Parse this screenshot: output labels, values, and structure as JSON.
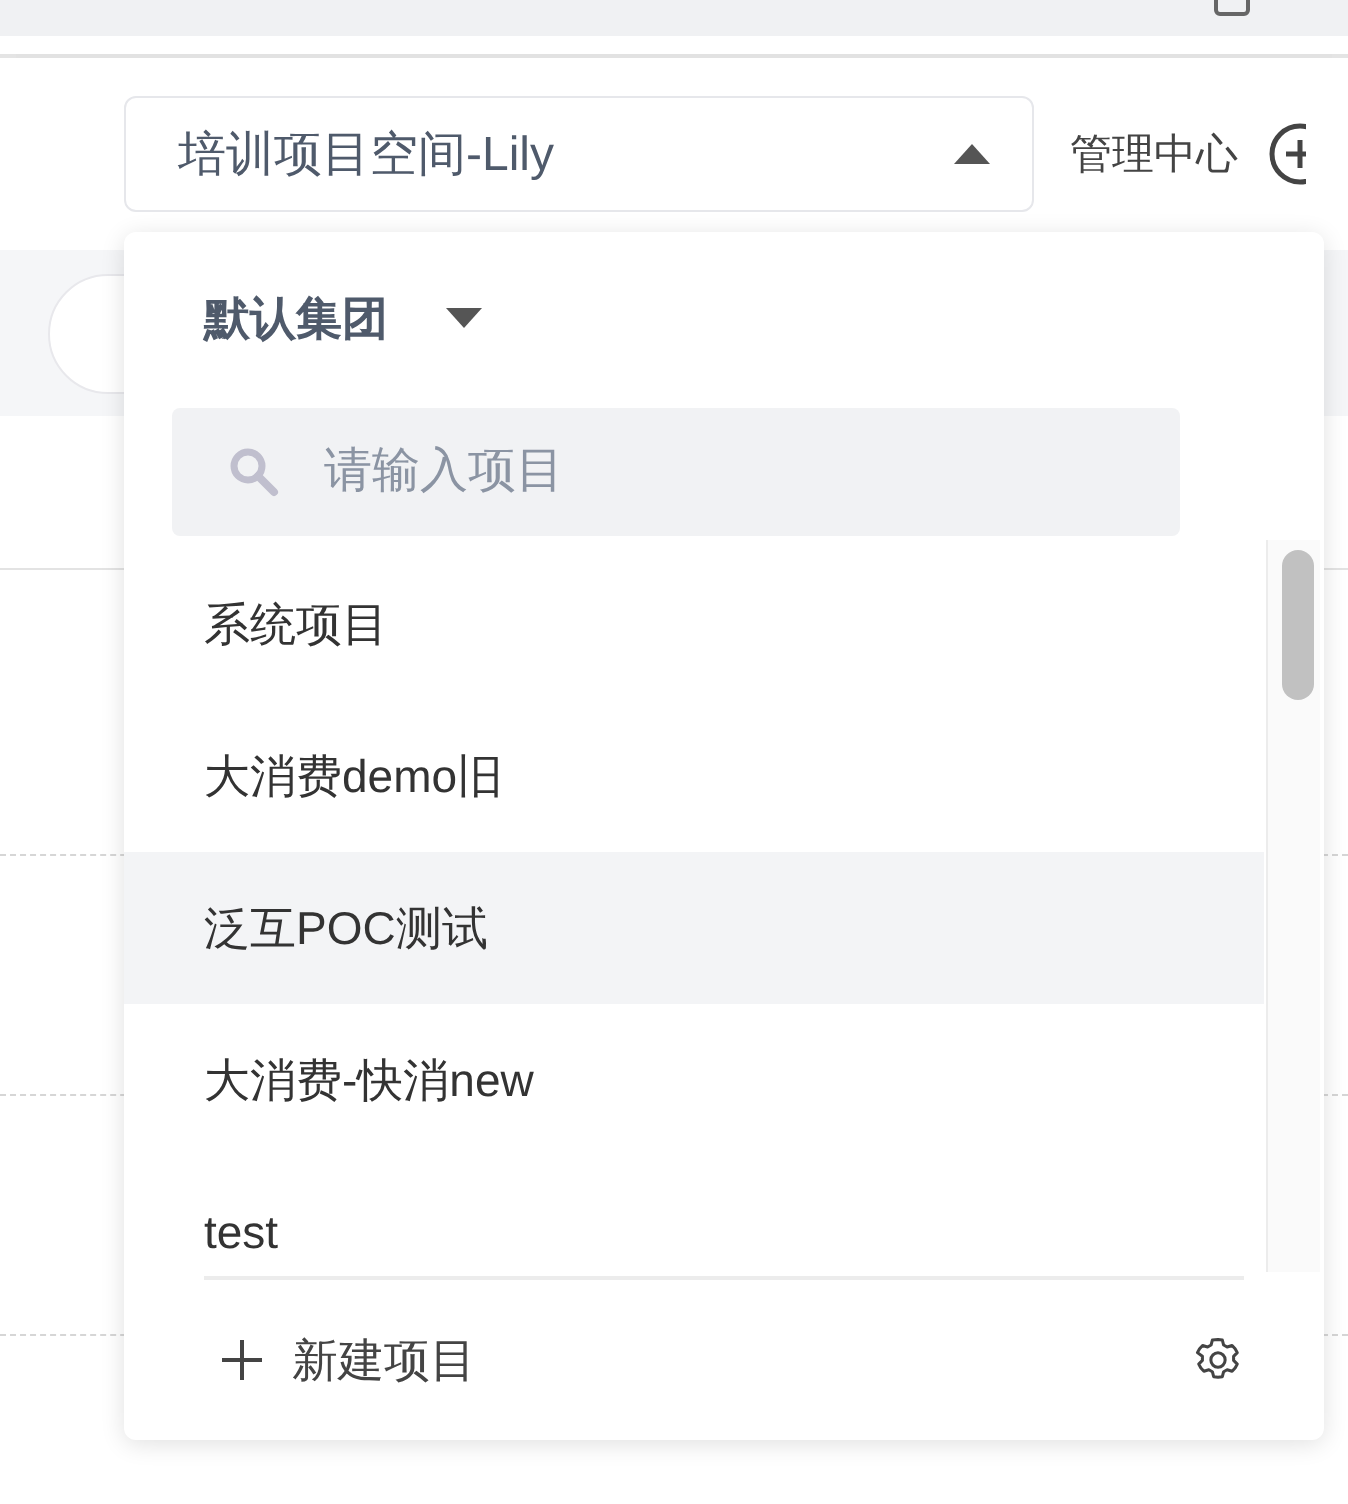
{
  "header": {
    "project_selector": {
      "value": "培训项目空间-Lily",
      "expanded": true
    },
    "admin_link": "管理中心"
  },
  "dropdown": {
    "group": "默认集团",
    "search": {
      "placeholder": "请输入项目"
    },
    "projects": [
      {
        "name": "系统项目",
        "highlighted": false
      },
      {
        "name": "大消费demo旧",
        "highlighted": false
      },
      {
        "name": "泛互POC测试",
        "highlighted": true
      },
      {
        "name": "大消费-快消new",
        "highlighted": false
      },
      {
        "name": "test",
        "highlighted": false
      }
    ],
    "create_label": "新建项目"
  }
}
